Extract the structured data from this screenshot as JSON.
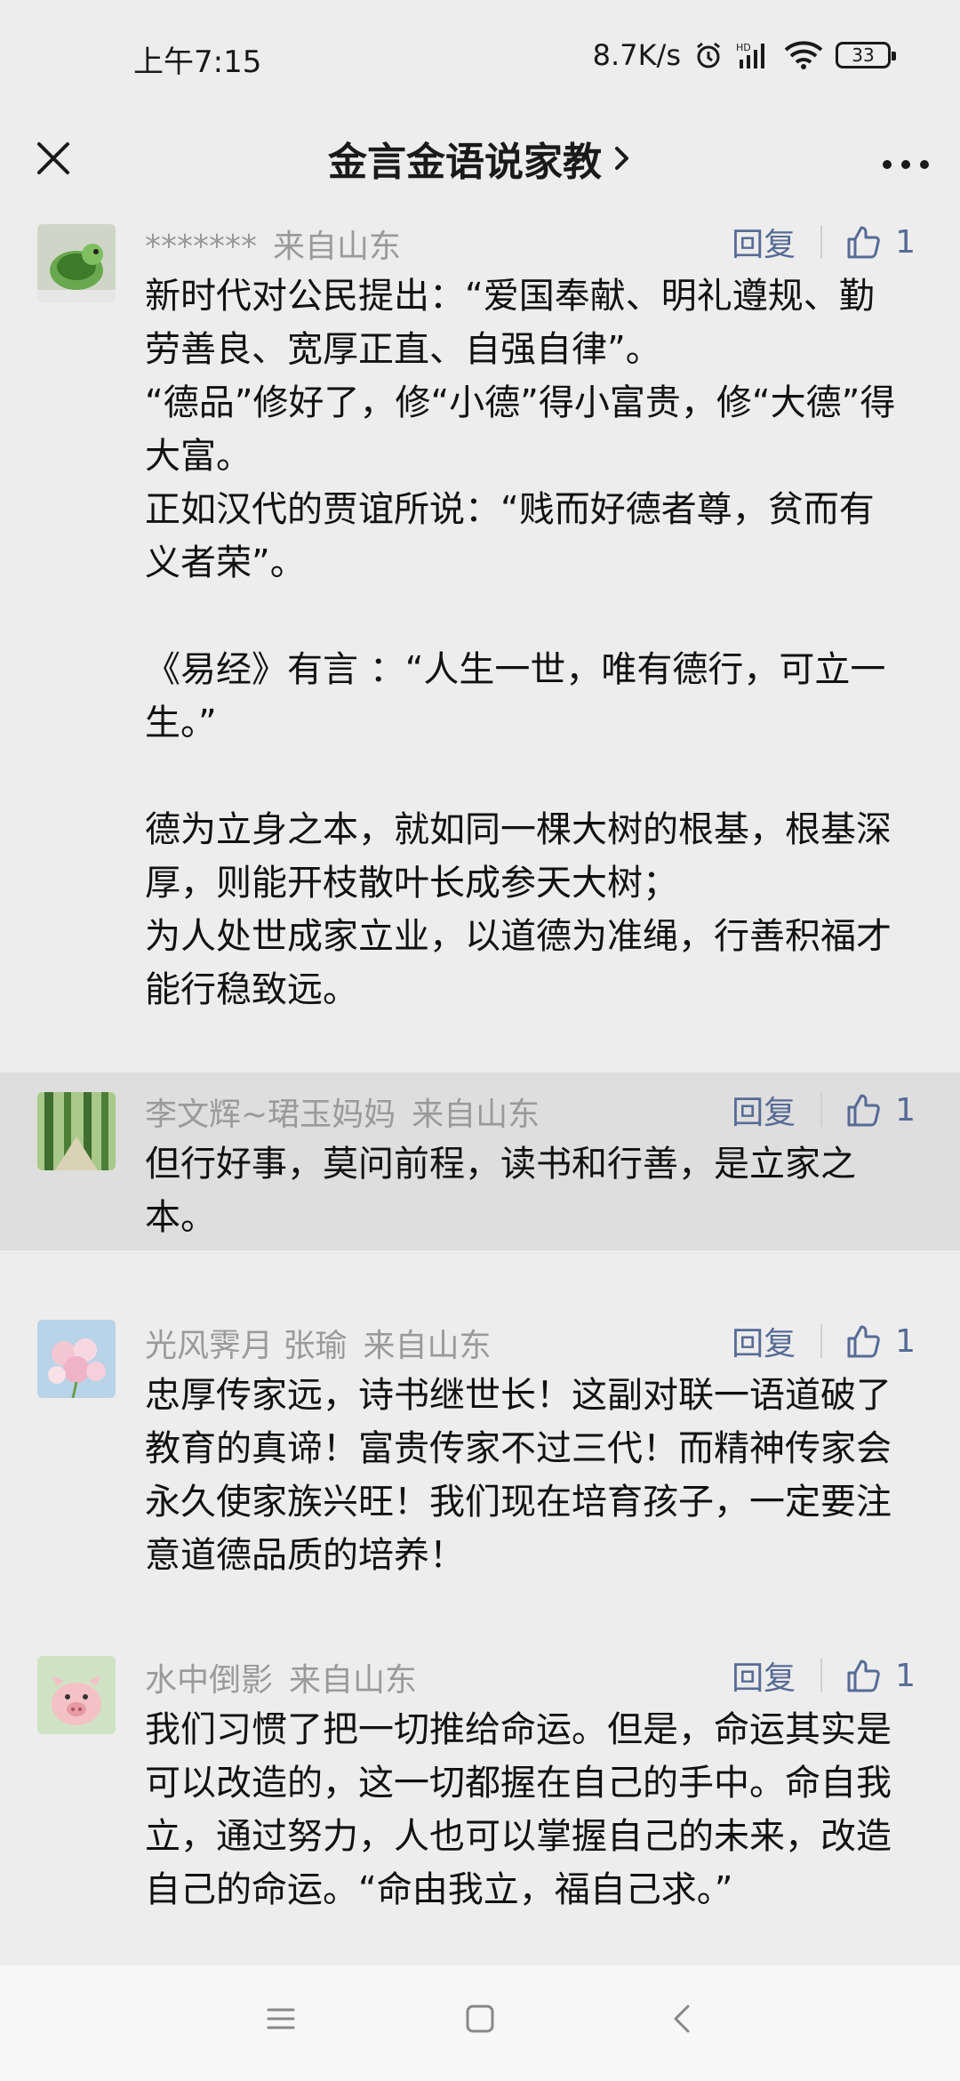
{
  "status_bar": {
    "time": "上午7:15",
    "network_speed": "8.7K/s",
    "battery": "33",
    "icons": [
      "alarm-icon",
      "hd-signal-icon",
      "wifi-icon",
      "battery-icon"
    ]
  },
  "nav": {
    "title": "金言金语说家教",
    "close_icon": "close-icon",
    "more_icon": "more-icon"
  },
  "comments": [
    {
      "user": "*******",
      "location": "来自山东",
      "reply_label": "回复",
      "likes": "1",
      "content": "新时代对公民提出：“爱国奉献、明礼遵规、勤劳善良、宽厚正直、自强自律”。\n“德品”修好了，修“小德”得小富贵，修“大德”得大富。\n正如汉代的贾谊所说：“贱而好德者尊，贫而有义者荣”。\n\n《易经》有言 ：“人生一世，唯有德行，可立一生。”\n\n德为立身之本，就如同一棵大树的根基，根基深厚，则能开枝散叶长成参天大树；\n为人处世成家立业，以道德为准绳，行善积福才能行稳致远。"
    },
    {
      "user": "李文辉~珺玉妈妈",
      "location": "来自山东",
      "reply_label": "回复",
      "likes": "1",
      "content": "但行好事，莫问前程，读书和行善，是立家之本。"
    },
    {
      "user": "光风霁月 张瑜",
      "location": "来自山东",
      "reply_label": "回复",
      "likes": "1",
      "content": "忠厚传家远，诗书继世长！这副对联一语道破了教育的真谛！富贵传家不过三代！而精神传家会永久使家族兴旺！我们现在培育孩子，一定要注意道德品质的培养！"
    },
    {
      "user": "水中倒影",
      "location": "来自山东",
      "reply_label": "回复",
      "likes": "1",
      "content": "我们习惯了把一切推给命运。但是，命运其实是可以改造的，这一切都握在自己的手中。命自我立，通过努力，人也可以掌握自己的未来，改造自己的命运。“命由我立，福自己求。”"
    }
  ],
  "bottom_bar": {
    "icons": [
      "menu-icon",
      "home-icon",
      "back-icon"
    ]
  }
}
